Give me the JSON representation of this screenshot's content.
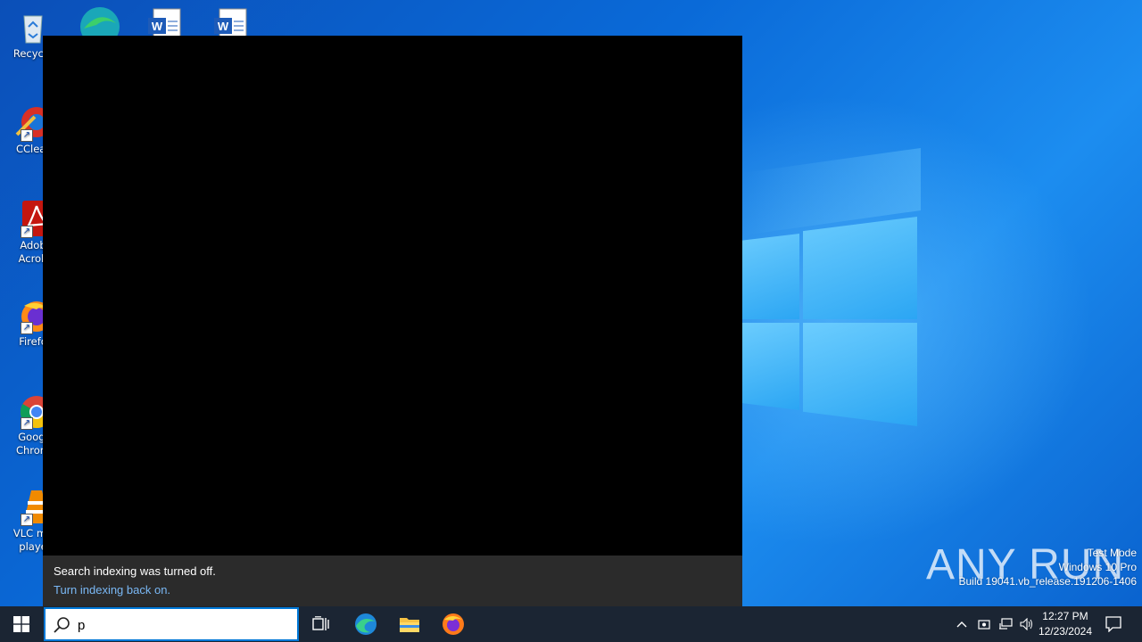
{
  "desktop": {
    "icons": [
      {
        "label": "Recycle",
        "label2": ""
      },
      {
        "label": "CClear",
        "label2": ""
      },
      {
        "label": "Adob",
        "label2": "Acrob"
      },
      {
        "label": "Firefo",
        "label2": ""
      },
      {
        "label": "Googl",
        "label2": "Chrom"
      },
      {
        "label": "VLC me",
        "label2": "playe"
      }
    ]
  },
  "search_flyout": {
    "notice_text": "Search indexing was turned off.",
    "notice_link": "Turn indexing back on."
  },
  "watermark": {
    "logo": "ANY RUN",
    "line1": "Test Mode",
    "line2": "Windows 10 Pro",
    "line3": "Build 19041.vb_release.191206-1406"
  },
  "taskbar": {
    "search_value": "p",
    "clock_time": "12:27 PM",
    "clock_date": "12/23/2024"
  },
  "colors": {
    "accent": "#0078d7",
    "link": "#7ab8f5",
    "taskbar": "#1b2533"
  }
}
